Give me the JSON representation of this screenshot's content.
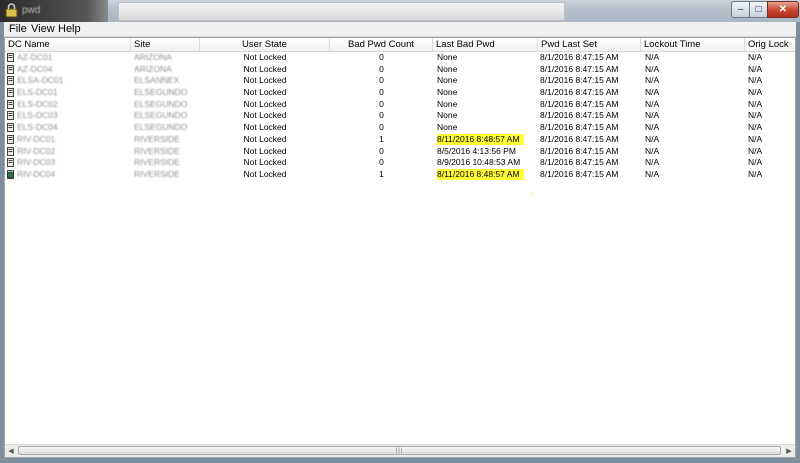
{
  "window": {
    "title": "pwd",
    "minimize": "0",
    "maximize": "1",
    "close": "r"
  },
  "menu": [
    "File",
    "View",
    "Help"
  ],
  "columns": [
    "DC Name",
    "Site",
    "User State",
    "Bad Pwd Count",
    "Last Bad Pwd",
    "Pwd Last Set",
    "Lockout Time",
    "Orig Lock"
  ],
  "rows": [
    {
      "dc": "AZ-DC01",
      "site": "ARIZONA",
      "state": "Not Locked",
      "count": "0",
      "last_bad": "None",
      "pwd_set": "8/1/2016 8:47:15 AM",
      "lockout": "N/A",
      "orig": "N/A",
      "highlight": false
    },
    {
      "dc": "AZ-DC04",
      "site": "ARIZONA",
      "state": "Not Locked",
      "count": "0",
      "last_bad": "None",
      "pwd_set": "8/1/2016 8:47:15 AM",
      "lockout": "N/A",
      "orig": "N/A",
      "highlight": false
    },
    {
      "dc": "ELSA-DC01",
      "site": "ELSANNEX",
      "state": "Not Locked",
      "count": "0",
      "last_bad": "None",
      "pwd_set": "8/1/2016 8:47:15 AM",
      "lockout": "N/A",
      "orig": "N/A",
      "highlight": false
    },
    {
      "dc": "ELS-DC01",
      "site": "ELSEGUNDO",
      "state": "Not Locked",
      "count": "0",
      "last_bad": "None",
      "pwd_set": "8/1/2016 8:47:15 AM",
      "lockout": "N/A",
      "orig": "N/A",
      "highlight": false
    },
    {
      "dc": "ELS-DC02",
      "site": "ELSEGUNDO",
      "state": "Not Locked",
      "count": "0",
      "last_bad": "None",
      "pwd_set": "8/1/2016 8:47:15 AM",
      "lockout": "N/A",
      "orig": "N/A",
      "highlight": false
    },
    {
      "dc": "ELS-DC03",
      "site": "ELSEGUNDO",
      "state": "Not Locked",
      "count": "0",
      "last_bad": "None",
      "pwd_set": "8/1/2016 8:47:15 AM",
      "lockout": "N/A",
      "orig": "N/A",
      "highlight": false
    },
    {
      "dc": "ELS-DC04",
      "site": "ELSEGUNDO",
      "state": "Not Locked",
      "count": "0",
      "last_bad": "None",
      "pwd_set": "8/1/2016 8:47:15 AM",
      "lockout": "N/A",
      "orig": "N/A",
      "highlight": false
    },
    {
      "dc": "RIV-DC01",
      "site": "RIVERSIDE",
      "state": "Not Locked",
      "count": "1",
      "last_bad": "8/11/2016 8:48:57 AM",
      "pwd_set": "8/1/2016 8:47:15 AM",
      "lockout": "N/A",
      "orig": "N/A",
      "highlight": true
    },
    {
      "dc": "RIV-DC02",
      "site": "RIVERSIDE",
      "state": "Not Locked",
      "count": "0",
      "last_bad": "8/5/2016 4:13:56 PM",
      "pwd_set": "8/1/2016 8:47:15 AM",
      "lockout": "N/A",
      "orig": "N/A",
      "highlight": false
    },
    {
      "dc": "RIV-DC03",
      "site": "RIVERSIDE",
      "state": "Not Locked",
      "count": "0",
      "last_bad": "8/9/2016 10:48:53 AM",
      "pwd_set": "8/1/2016 8:47:15 AM",
      "lockout": "N/A",
      "orig": "N/A",
      "highlight": false
    },
    {
      "dc": "RIV-DC04",
      "site": "RIVERSIDE",
      "state": "Not Locked",
      "count": "1",
      "last_bad": "8/11/2016 8:48:57 AM",
      "pwd_set": "8/1/2016 8:47:15 AM",
      "lockout": "N/A",
      "orig": "N/A",
      "highlight": true
    }
  ],
  "scrollbar": {
    "left_arrow": "◀",
    "right_arrow": "▶",
    "thumb_grip": "|||"
  },
  "colors": {
    "highlight": "#ffff33",
    "window_bg": "#7f8e9c"
  },
  "icons": {
    "app": "padlock-icon",
    "dc": "server-icon"
  }
}
